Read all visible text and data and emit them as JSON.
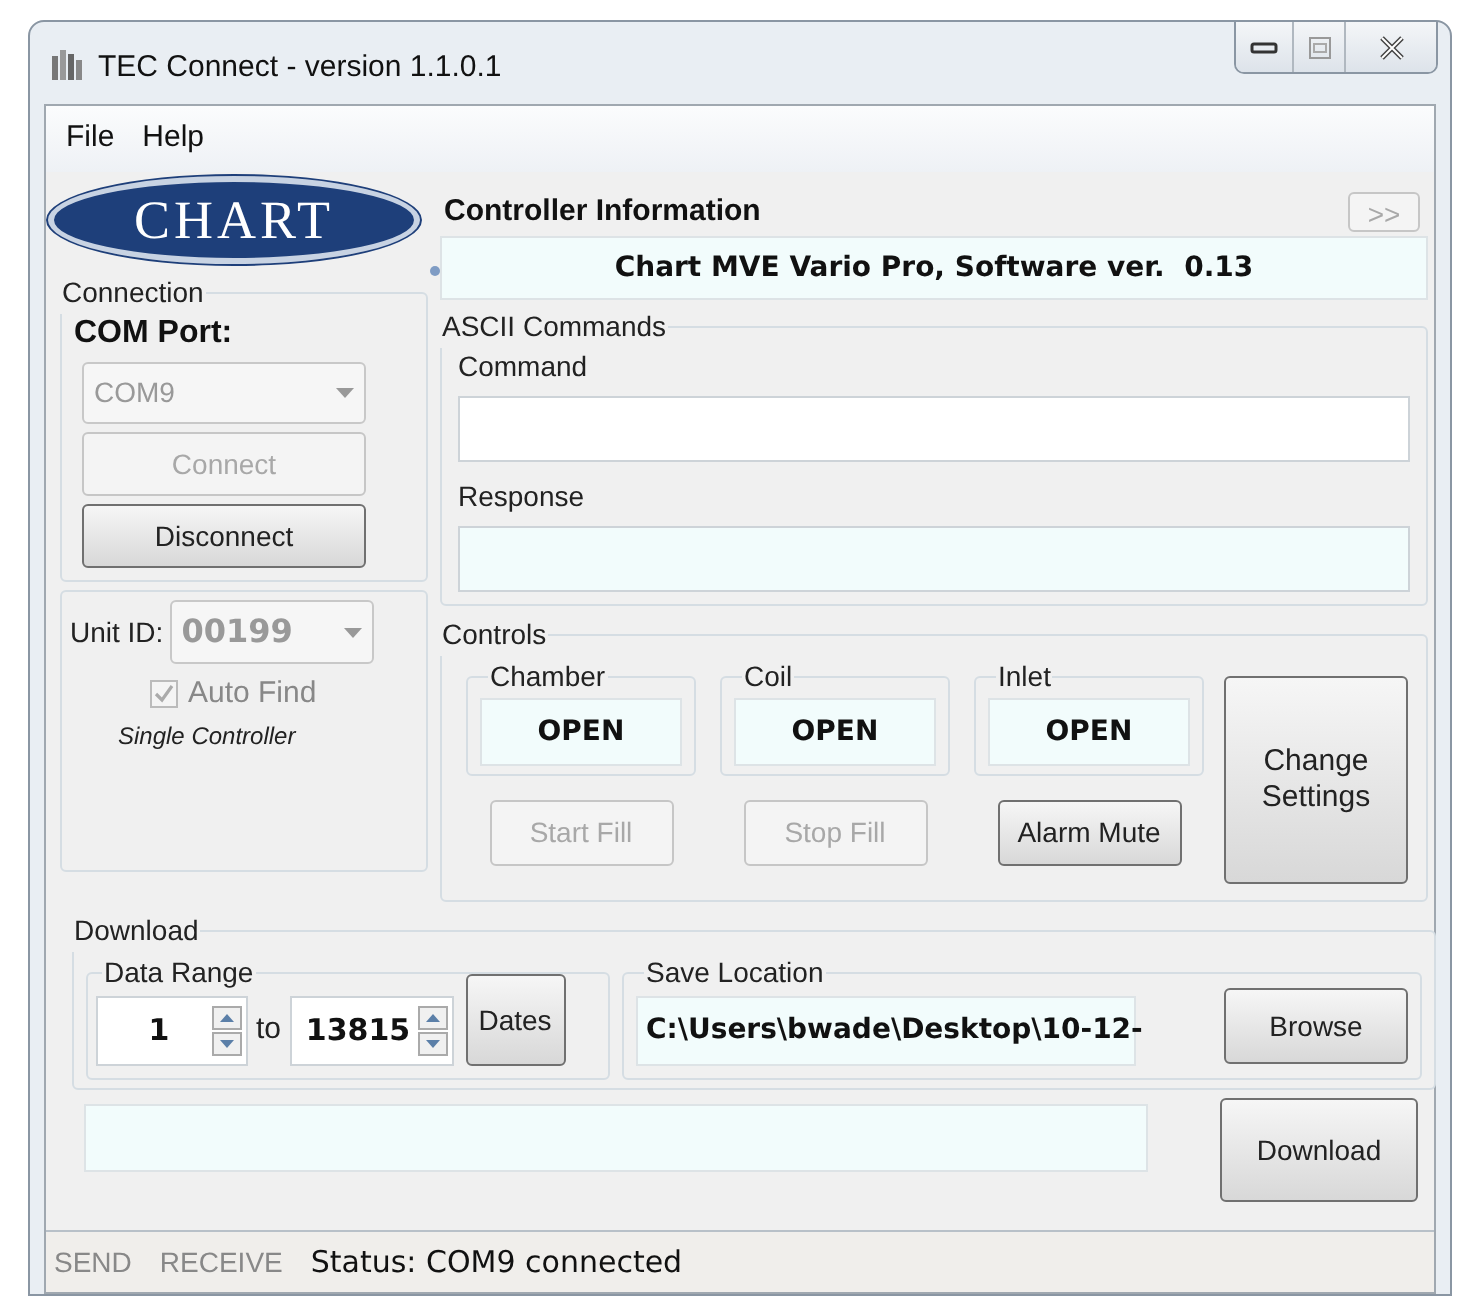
{
  "window": {
    "title": "TEC Connect - version 1.1.0.1"
  },
  "menu": [
    {
      "label": "File"
    },
    {
      "label": "Help"
    }
  ],
  "logo": {
    "text": "CHART"
  },
  "connection": {
    "group_label": "Connection",
    "com_port_label": "COM Port:",
    "com_port": {
      "value": "COM9",
      "disabled": true
    },
    "buttons": [
      {
        "label": "Connect",
        "disabled": true
      },
      {
        "label": "Disconnect",
        "disabled": false
      }
    ]
  },
  "unit": {
    "label": "Unit ID:",
    "value": "00199",
    "disabled": true,
    "auto_find": {
      "label": "Auto Find",
      "checked": true,
      "disabled": true
    },
    "caption": "Single Controller"
  },
  "controller_information": {
    "heading": "Controller Information",
    "expand_button": {
      "label": ">>",
      "disabled": true
    },
    "value": "Chart MVE Vario Pro, Software ver.  0.13"
  },
  "ascii_commands": {
    "group_label": "ASCII Commands",
    "command_label": "Command",
    "response_label": "Response"
  },
  "controls": {
    "group_label": "Controls",
    "valves": [
      {
        "name": "Chamber",
        "state": "OPEN",
        "button": {
          "label": "Start Fill",
          "disabled": true
        }
      },
      {
        "name": "Coil",
        "state": "OPEN",
        "button": {
          "label": "Stop Fill",
          "disabled": true
        }
      },
      {
        "name": "Inlet",
        "state": "OPEN",
        "button": {
          "label": "Alarm Mute",
          "disabled": false
        }
      }
    ],
    "change_settings": {
      "label": "Change Settings",
      "disabled": false
    }
  },
  "download": {
    "group_label": "Download",
    "data_range": {
      "label": "Data Range",
      "from": "1",
      "to_label": "to",
      "to": "13815",
      "dates_button": "Dates"
    },
    "save_location": {
      "label": "Save Location",
      "path": "C:\\Users\\bwade\\Desktop\\10-12-",
      "browse_button": "Browse"
    },
    "download_button": "Download"
  },
  "status_bar": {
    "indicators": [
      {
        "label": "SEND",
        "active": false
      },
      {
        "label": "RECEIVE",
        "active": false
      }
    ],
    "status": "Status: COM9 connected"
  }
}
